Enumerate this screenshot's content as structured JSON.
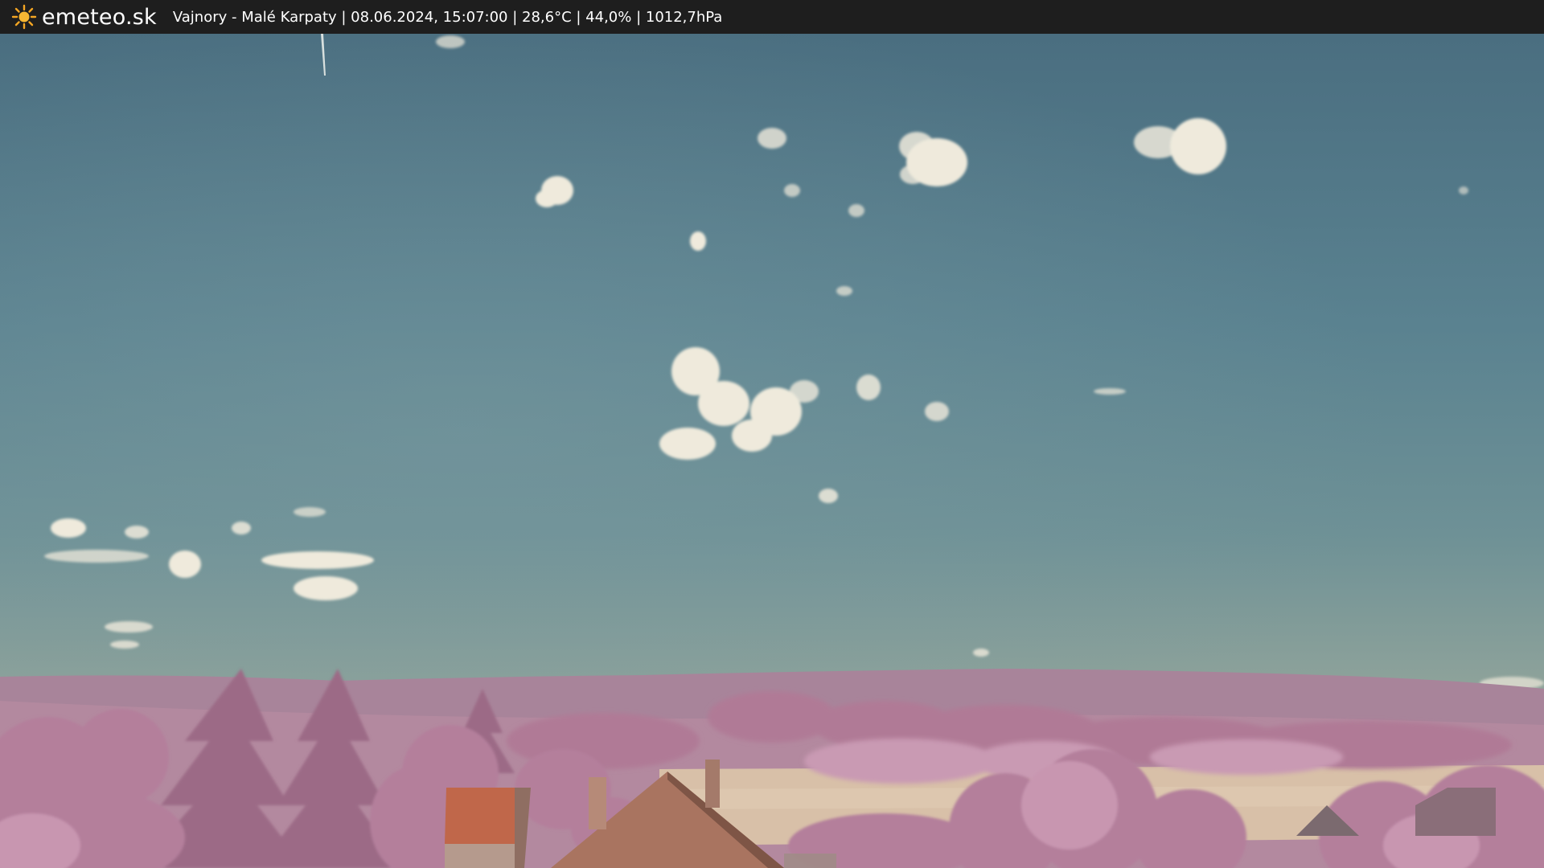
{
  "header": {
    "brand": "emeteo.sk",
    "caption": "Vajnory - Malé Karpaty | 08.06.2024, 15:07:00 | 28,6°C | 44,0% | 1012,7hPa",
    "logo_icon": "sun-icon",
    "logo_color": "#f5a623"
  },
  "colors": {
    "bar": "#1e1e1e",
    "sky_top": "#4a6f80",
    "sky_bottom": "#a7b4a3",
    "foliage": "#b8889f",
    "roof": "#c0674a"
  }
}
